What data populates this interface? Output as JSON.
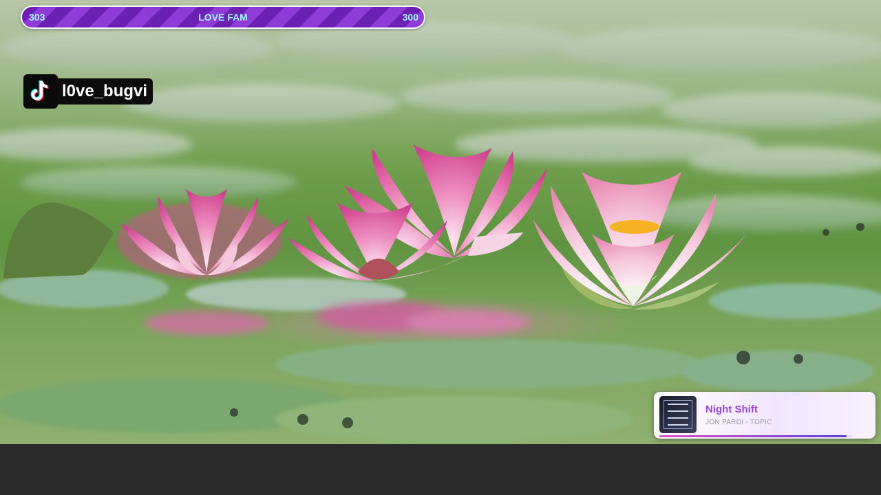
{
  "goal_bar": {
    "left_count": "303",
    "title": "LOVE FAM",
    "right_count": "300"
  },
  "tiktok": {
    "icon": "tiktok-icon",
    "handle": "l0ve_bugvi"
  },
  "now_playing": {
    "title": "Night Shift",
    "artist": "JON PARDI - TOPIC",
    "progress_fraction": 0.97,
    "colors": {
      "title": "#9a44d6",
      "progress_start": "#e052c8",
      "progress_end": "#5a3fd8"
    }
  },
  "colors": {
    "goal_stripe_dark": "#6b1fb3",
    "goal_stripe_light": "#8e3bd8",
    "goal_text": "#9ff7ff"
  }
}
